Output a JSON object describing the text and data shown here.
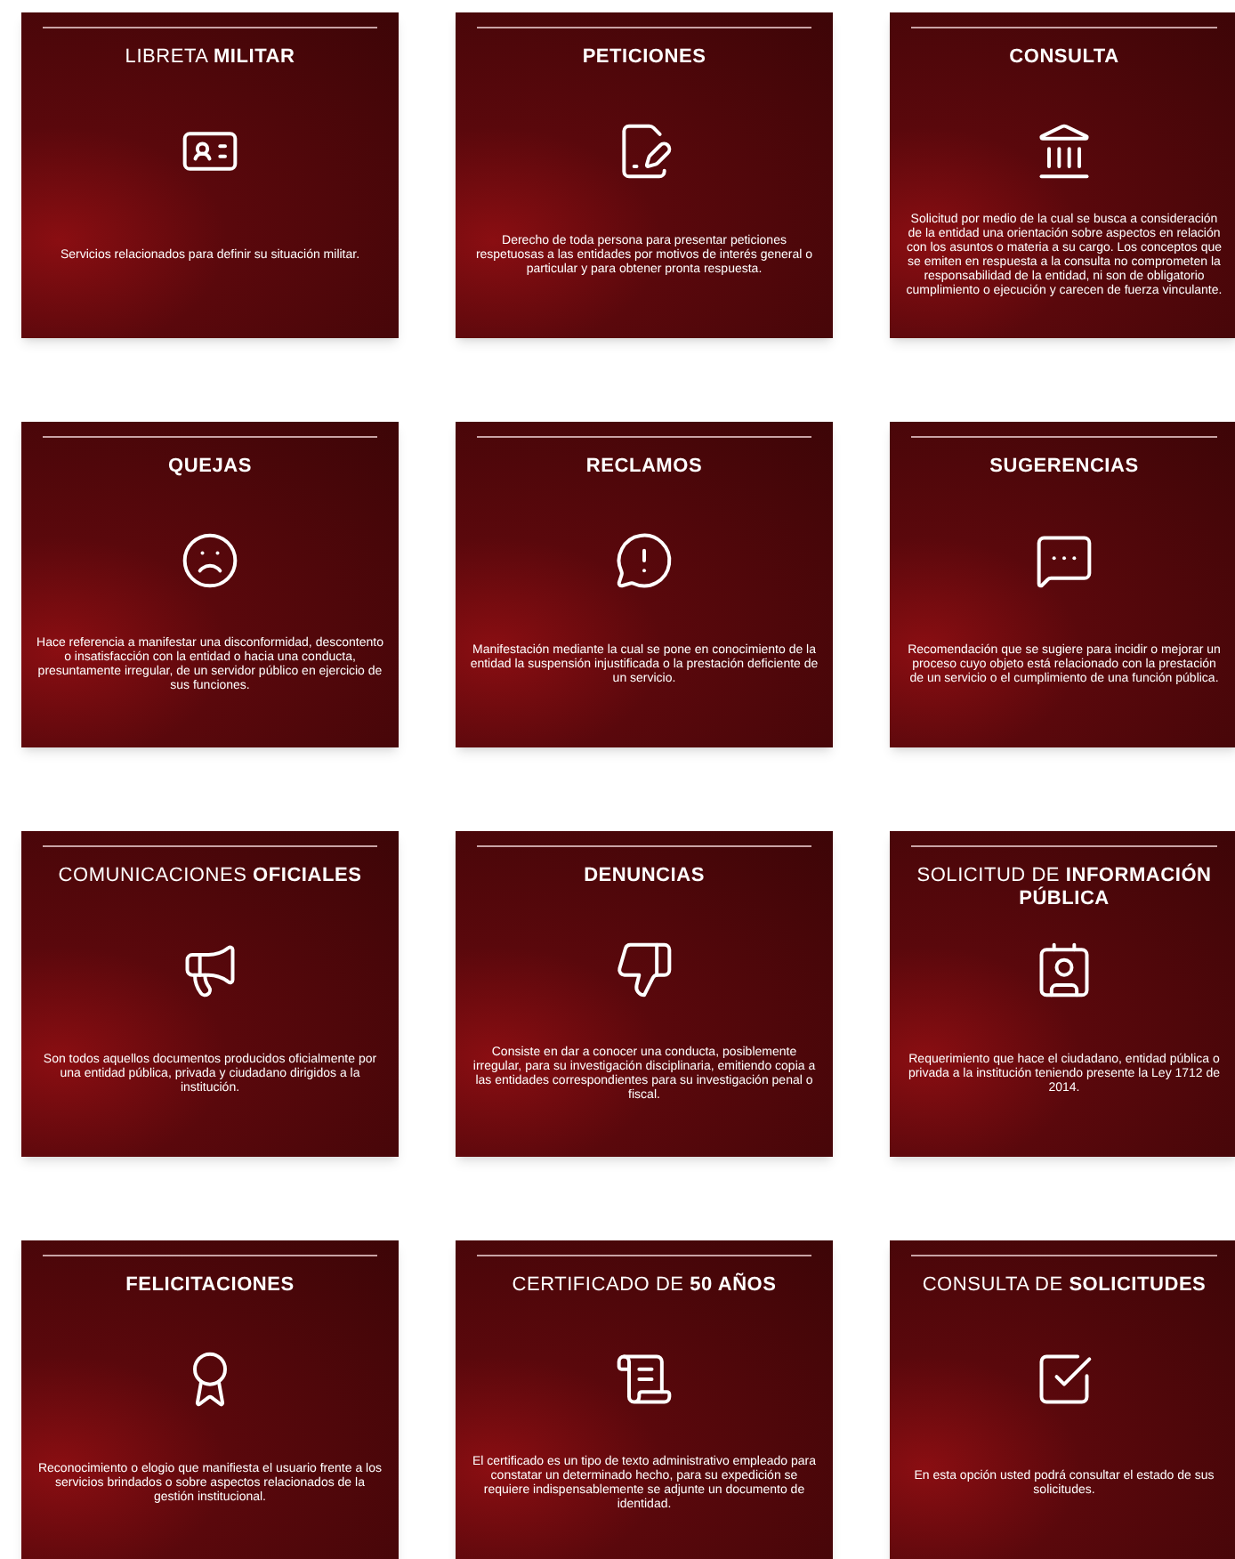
{
  "cards": [
    {
      "title": "LIBRETA **MILITAR**",
      "kind": "mixed",
      "description": "Servicios relacionados para definir su situación militar."
    },
    {
      "title": "PETICIONES",
      "kind": "bold",
      "description": "Derecho de toda persona para presentar peticiones respetuosas a las entidades por motivos de interés general o particular y para obtener pronta respuesta."
    },
    {
      "title": "CONSULTA",
      "kind": "bold",
      "description": "Solicitud por medio de la cual se busca a consideración de la entidad una orientación sobre aspectos en relación con los asuntos o materia a su cargo. Los conceptos que se emiten en respuesta a la consulta no comprometen la responsabilidad de la entidad, ni son de obligatorio cumplimiento o ejecución y carecen de fuerza vinculante."
    },
    {
      "title": "QUEJAS",
      "kind": "bold",
      "description": "Hace referencia a manifestar una disconformidad, descontento  o insatisfacción con la entidad o hacia una conducta, presuntamente irregular, de un servidor público en ejercicio de sus funciones."
    },
    {
      "title": "RECLAMOS",
      "kind": "bold",
      "description": "Manifestación mediante la cual se pone en conocimiento de la entidad la suspensión injustificada o la prestación deficiente de un servicio."
    },
    {
      "title": "SUGERENCIAS",
      "kind": "bold",
      "description": "Recomendación que se sugiere para incidir o mejorar un proceso cuyo objeto está relacionado con la prestación de un servicio o el cumplimiento de una función pública."
    },
    {
      "title": "COMUNICACIONES **OFICIALES**",
      "kind": "mixed",
      "description": "Son todos aquellos documentos producidos oficialmente por una entidad pública, privada y ciudadano dirigidos a la institución."
    },
    {
      "title": "DENUNCIAS",
      "kind": "bold",
      "description": "Consiste en dar a conocer una conducta, posiblemente irregular, para su investigación disciplinaria, emitiendo copia a las entidades correspondientes para su investigación penal o fiscal."
    },
    {
      "title": "SOLICITUD DE **INFORMACIÓN PÚBLICA**",
      "kind": "mixed",
      "description": "Requerimiento que hace el ciudadano, entidad pública o privada a la institución teniendo presente la Ley 1712 de 2014."
    },
    {
      "title": "FELICITACIONES",
      "kind": "bold",
      "description": "Reconocimiento o elogio que manifiesta el usuario frente a los servicios brindados o sobre aspectos relacionados de la gestión institucional."
    },
    {
      "title": "CERTIFICADO DE **50 AÑOS**",
      "kind": "mixed",
      "description": "El certificado es un tipo de texto administrativo empleado para constatar un determinado hecho, para su expedición se requiere indispensablemente se adjunte un documento de identidad."
    },
    {
      "title": "CONSULTA DE **SOLICITUDES**",
      "kind": "mixed",
      "description": "En esta opción usted podrá consultar el estado de sus solicitudes."
    }
  ]
}
